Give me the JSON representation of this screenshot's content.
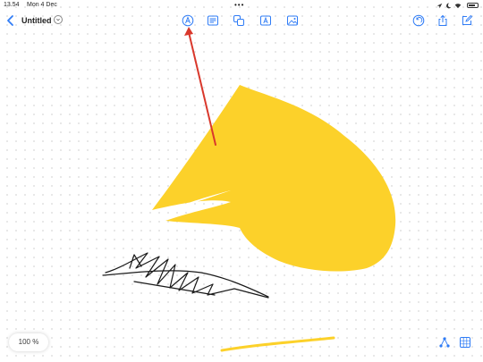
{
  "status_bar": {
    "time": "13.54",
    "date": "Mon 4 Dec",
    "more": "•••",
    "battery_label": ""
  },
  "toolbar": {
    "title": "Untitled",
    "tools": [
      "pen-tool-icon",
      "notes-icon",
      "shapes-icon",
      "text-box-icon",
      "image-icon"
    ],
    "right_actions": [
      "undo-icon",
      "share-icon",
      "compose-icon"
    ]
  },
  "canvas": {
    "shape_color": "#FCD12A",
    "ink_color": "#1a1a1a",
    "annotation_color": "#D9382C"
  },
  "bottom_bar": {
    "zoom": "100 %",
    "left_tools": [
      "connect-icon",
      "grid-icon"
    ]
  },
  "colors": {
    "accent": "#2F7CF6"
  }
}
